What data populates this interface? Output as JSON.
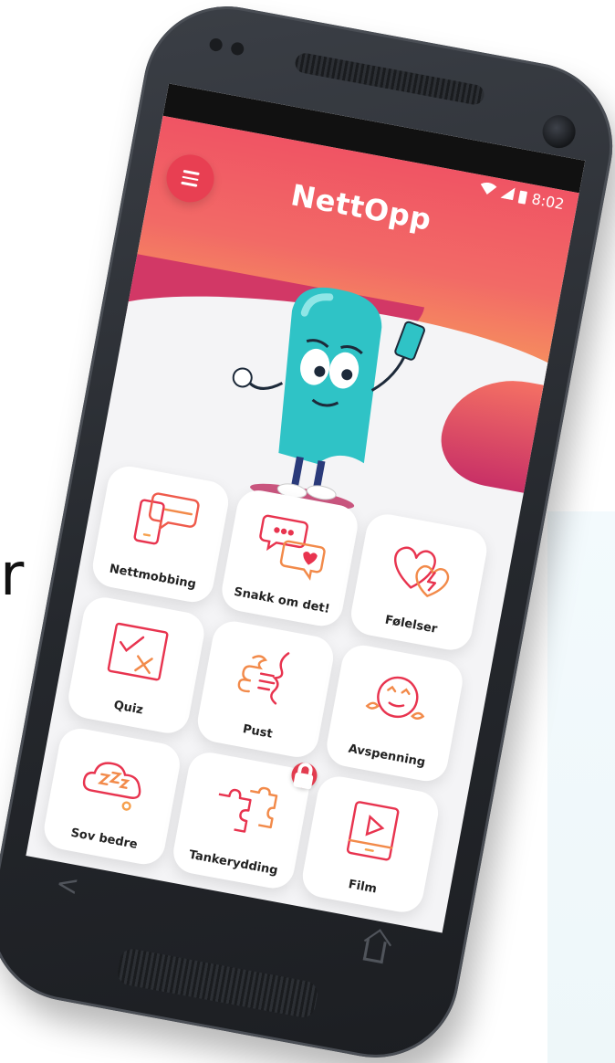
{
  "background": {
    "partial_text": "r"
  },
  "status_bar": {
    "time": "8:02"
  },
  "header": {
    "app_title": "NettOpp"
  },
  "tiles": [
    {
      "label": "Nettmobbing",
      "icon": "phone-chat-icon",
      "locked": false
    },
    {
      "label": "Snakk om det!",
      "icon": "speech-bubbles-icon",
      "locked": false
    },
    {
      "label": "Følelser",
      "icon": "hearts-icon",
      "locked": false
    },
    {
      "label": "Quiz",
      "icon": "quiz-check-icon",
      "locked": false
    },
    {
      "label": "Pust",
      "icon": "breath-icon",
      "locked": false
    },
    {
      "label": "Avspenning",
      "icon": "relax-face-icon",
      "locked": false
    },
    {
      "label": "Sov bedre",
      "icon": "sleep-cloud-icon",
      "locked": false
    },
    {
      "label": "Tankerydding",
      "icon": "puzzle-icon",
      "locked": true
    },
    {
      "label": "Film",
      "icon": "video-icon",
      "locked": false
    }
  ],
  "colors": {
    "header_top": "#f05464",
    "header_bottom": "#f6955d",
    "accent": "#e83f52",
    "icon_stroke_start": "#e8344f",
    "icon_stroke_end": "#f6a04d",
    "mascot": "#2fc3c6"
  }
}
